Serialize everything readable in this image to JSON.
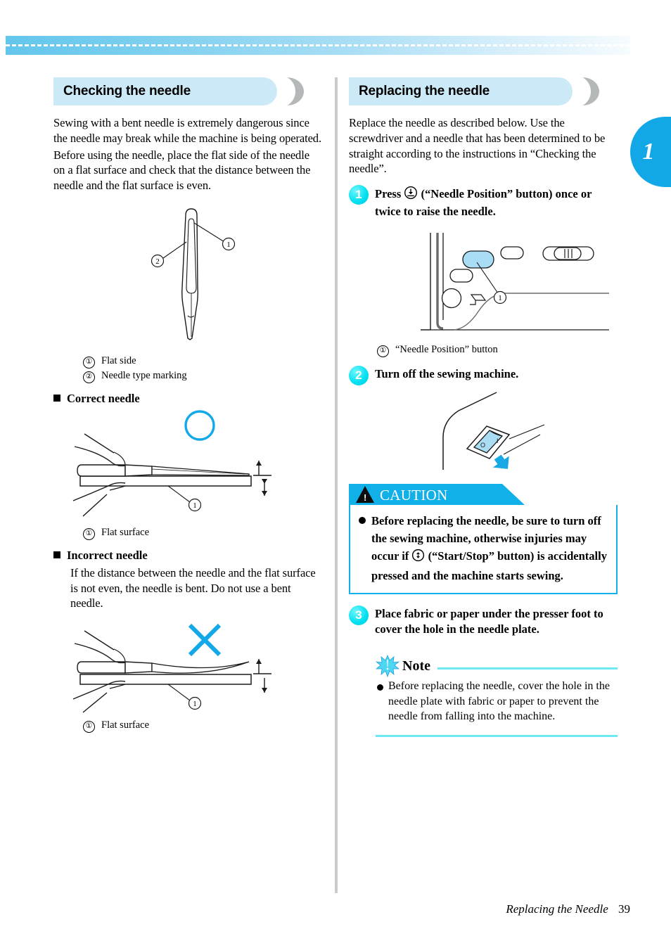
{
  "page": {
    "chapter_tab": "1",
    "footer_title": "Replacing the Needle",
    "footer_page": "39"
  },
  "left_column": {
    "heading": "Checking the needle",
    "intro_paragraph_1": "Sewing with a bent needle is extremely dangerous since the needle may break while the machine is being operated.",
    "intro_paragraph_2": "Before using the needle, place the flat side of the needle on a flat surface and check that the distance between the needle and the flat surface is even.",
    "needle_figure_legend": [
      {
        "num": "①",
        "label": "Flat side"
      },
      {
        "num": "②",
        "label": "Needle type marking"
      }
    ],
    "correct_heading": "Correct needle",
    "correct_legend": [
      {
        "num": "①",
        "label": "Flat surface"
      }
    ],
    "incorrect_heading": "Incorrect needle",
    "incorrect_paragraph": "If the distance between the needle and the flat surface is not even, the needle is bent. Do not use a bent needle.",
    "incorrect_legend": [
      {
        "num": "①",
        "label": "Flat surface"
      }
    ]
  },
  "right_column": {
    "heading": "Replacing the needle",
    "intro_paragraph": "Replace the needle as described below. Use the screwdriver and a needle that has been determined to be straight according to the instructions in “Checking the needle”.",
    "steps": [
      {
        "number": "1",
        "text_before_icon": "Press",
        "icon": "needle-position-icon",
        "text_after_icon": "(“Needle Position” button) once or twice to raise the needle."
      },
      {
        "number": "2",
        "text": "Turn off the sewing machine."
      },
      {
        "number": "3",
        "text": "Place fabric or paper under the presser foot to cover the hole in the needle plate."
      }
    ],
    "machine_figure_legend": [
      {
        "num": "①",
        "label": "“Needle Position” button"
      }
    ],
    "caution": {
      "title": "CAUTION",
      "items": [
        {
          "text_before_icon": "Before replacing the needle, be sure to turn off the sewing machine, otherwise injuries may occur if",
          "icon": "start-stop-icon",
          "text_after_icon": "(“Start/Stop” button) is accidentally pressed and the machine starts sewing."
        }
      ]
    },
    "note": {
      "title": "Note",
      "items": [
        "Before replacing the needle, cover the hole in the needle plate with fabric or paper to prevent the needle from falling into the machine."
      ]
    }
  },
  "colors": {
    "accent_cyan": "#12b0e8",
    "header_bar_blue": "#cbe9f6",
    "step_circle": "#00dff0",
    "note_rule": "#6fe8f5",
    "tab_blue": "#12a8e8",
    "divider_gray": "#c9cbcc"
  }
}
